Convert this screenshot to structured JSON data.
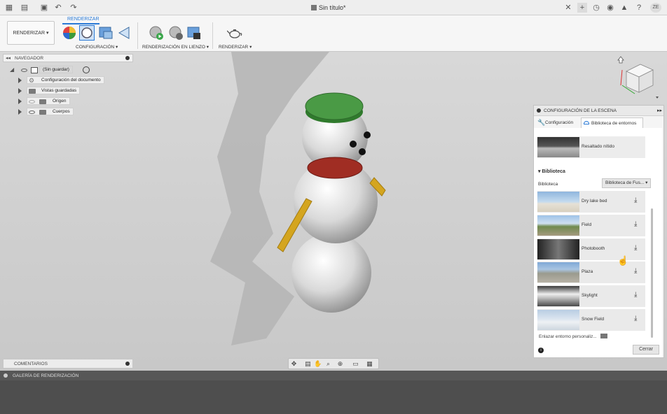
{
  "window": {
    "title": "Sin título*"
  },
  "ribbon": {
    "active_tab": "RENDERIZAR",
    "workspace_button": "RENDERIZAR",
    "groups": [
      {
        "label": "CONFIGURACIÓN"
      },
      {
        "label": "RENDERIZACIÓN EN LIENZO"
      },
      {
        "label": "RENDERIZAR"
      }
    ]
  },
  "navigator": {
    "title": "NAVEGADOR",
    "root_label": "(Sin guardar)",
    "items": [
      {
        "label": "Configuración del documento"
      },
      {
        "label": "Vistas guardadas"
      },
      {
        "label": "Origen"
      },
      {
        "label": "Cuerpos"
      }
    ]
  },
  "scene_settings": {
    "title": "CONFIGURACIÓN DE LA ESCENA",
    "tabs": [
      {
        "label": "Configuración"
      },
      {
        "label": "Biblioteca de entornos"
      }
    ],
    "current_environment": "Resaltado nítido",
    "library_section": "Biblioteca",
    "library_label": "Biblioteca",
    "library_select": "Biblioteca de Fus...",
    "environments": [
      {
        "name": "Dry lake bed"
      },
      {
        "name": "Field"
      },
      {
        "name": "Photobooth"
      },
      {
        "name": "Plaza"
      },
      {
        "name": "Skylight"
      },
      {
        "name": "Snow Field"
      }
    ],
    "link_custom": "Enlazar entorno personaliz...",
    "close_button": "Cerrar"
  },
  "comments": {
    "title": "COMENTARIOS"
  },
  "gallery": {
    "title": "GALERÍA DE RENDERIZACIÓN"
  },
  "colors": {
    "accent": "#2a7ad6",
    "hat": "#3f8a3a",
    "scarf": "#a02d23",
    "arm": "#d4a51f"
  }
}
